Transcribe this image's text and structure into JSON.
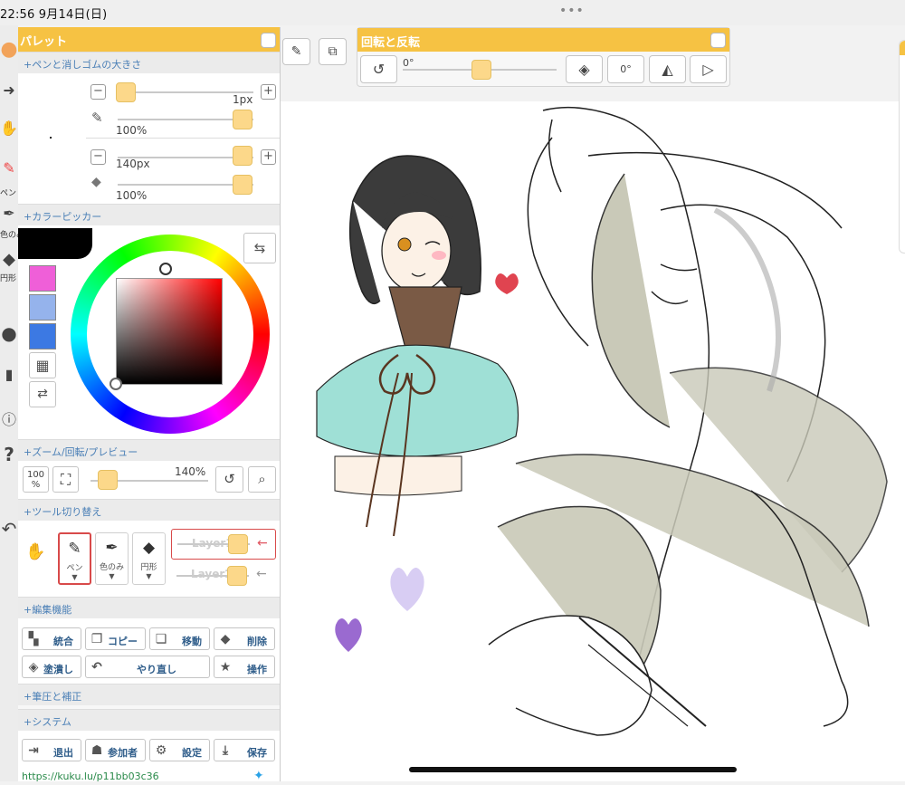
{
  "status_bar": {
    "time_date": "22:56 9月14日(日)",
    "dots": "•••"
  },
  "toolbar": {
    "pen_label": "ペン",
    "eyedropper_label": "色のみ",
    "circle_label": "円形"
  },
  "palette": {
    "title": "パレット",
    "pen_eraser_section": "+ペンと消しゴムの大きさ",
    "pen_size": "1px",
    "pen_opacity": "100%",
    "eraser_size": "140px",
    "eraser_opacity": "100%",
    "minus": "−",
    "plus": "+",
    "colorpicker_section": "+カラーピッカー",
    "swatches": [
      "#ef5fd8",
      "#95b3ec",
      "#3c79e3"
    ],
    "current_color": "#000000",
    "zoom_section": "+ズーム/回転/プレビュー",
    "zoom_100_label": "100\n%",
    "zoom_value": "140%",
    "tool_switch_section": "+ツール切り替え",
    "tools": [
      {
        "name": "ペン"
      },
      {
        "name": "色のみ"
      },
      {
        "name": "円形"
      }
    ],
    "layers": [
      "Layer1",
      "Layer2"
    ],
    "edit_section": "+編集機能",
    "edit_buttons": [
      {
        "label": "統合",
        "icon": "merge-icon"
      },
      {
        "label": "コピー",
        "icon": "copy-icon"
      },
      {
        "label": "移動",
        "icon": "move-icon"
      },
      {
        "label": "削除",
        "icon": "delete-icon"
      },
      {
        "label": "塗潰し",
        "icon": "fill-icon"
      },
      {
        "label": "やり直し",
        "icon": "redo-icon"
      },
      {
        "label": "操作",
        "icon": "star-icon"
      }
    ],
    "pressure_section": "+筆圧と補正",
    "system_section": "+システム",
    "system_buttons": [
      {
        "label": "退出",
        "icon": "exit-icon"
      },
      {
        "label": "参加者",
        "icon": "participants-icon"
      },
      {
        "label": "設定",
        "icon": "gear-icon"
      },
      {
        "label": "保存",
        "icon": "download-icon"
      }
    ],
    "link_text": "https://kuku.lu/p11bb03c36"
  },
  "rotate_panel": {
    "title": "回転と反転",
    "angle": "0°",
    "angle_btn": "0°"
  }
}
